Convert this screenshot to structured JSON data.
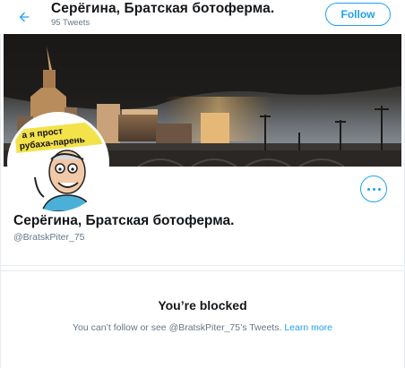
{
  "header": {
    "title": "Серёгина, Братская ботоферма.",
    "tweet_count": "95 Tweets",
    "follow_label": "Follow"
  },
  "profile": {
    "name": "Серёгина, Братская ботоферма.",
    "handle": "@BratskPiter_75",
    "avatar_sign_line1": "а я прост",
    "avatar_sign_line2": "рубаха-парень"
  },
  "blocked": {
    "heading": "You’re blocked",
    "message": "You can’t follow or see @BratskPiter_75’s Tweets.",
    "link": "Learn more"
  },
  "colors": {
    "accent": "#1da1f2",
    "secondary_text": "#657786",
    "divider": "#e6ecf0"
  },
  "icons": {
    "back": "arrow-left-icon",
    "more": "more-horizontal-icon"
  }
}
